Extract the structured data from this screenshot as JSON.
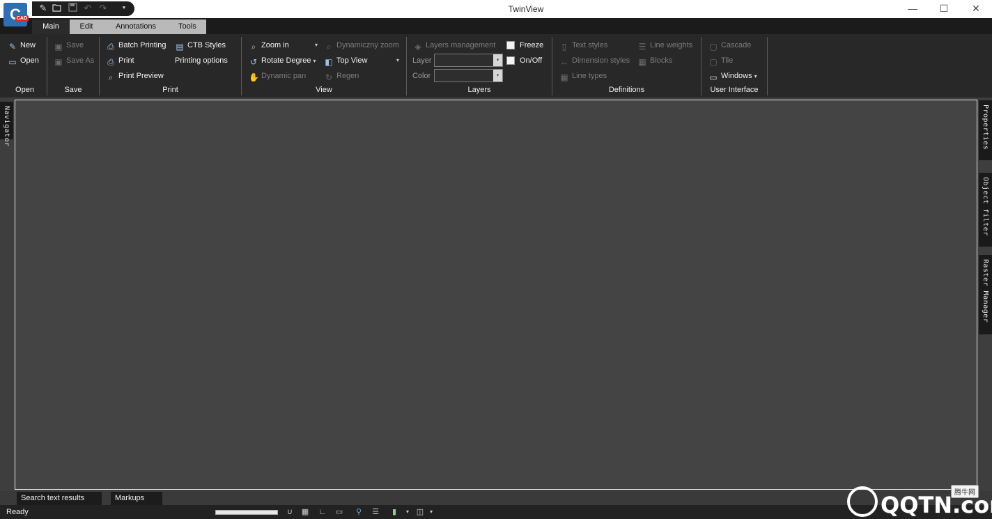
{
  "window": {
    "title": "TwinView",
    "logo_text": "C",
    "logo_badge": "CAD",
    "minimize": "—",
    "maximize": "☐",
    "close": "✕"
  },
  "quick_access": {
    "new_icon": "✎",
    "open_icon": "📂",
    "save_icon": "💾",
    "undo_icon": "↶",
    "redo_icon": "↷",
    "customize_icon": "⯆"
  },
  "tabs": [
    {
      "label": "Main"
    },
    {
      "label": "Edit"
    },
    {
      "label": "Annotations"
    },
    {
      "label": "Tools"
    }
  ],
  "ribbon": {
    "open": {
      "label": "Open",
      "new": "New",
      "open": "Open"
    },
    "save": {
      "label": "Save",
      "save": "Save",
      "save_as": "Save As"
    },
    "print": {
      "label": "Print",
      "batch_printing": "Batch Printing",
      "ctb_styles": "CTB Styles",
      "print": "Print",
      "printing_options": "Printing options",
      "print_preview": "Print Preview"
    },
    "view": {
      "label": "View",
      "zoom_in": "Zoom in",
      "dynamic_zoom": "Dynamiczny zoom",
      "rotate_degree": "Rotate Degree",
      "top_view": "Top View",
      "dynamic_pan": "Dynamic pan",
      "regen": "Regen"
    },
    "layers": {
      "label": "Layers",
      "layers_management": "Layers management",
      "freeze": "Freeze",
      "layer": "Layer",
      "on_off": "On/Off",
      "color": "Color",
      "layer_value": "",
      "color_value": ""
    },
    "definitions": {
      "label": "Definitions",
      "text_styles": "Text styles",
      "line_weights": "Line weights",
      "dimension_styles": "Dimension styles",
      "blocks": "Blocks",
      "line_types": "Line types"
    },
    "user_interface": {
      "label": "User Interface",
      "cascade": "Cascade",
      "tile": "Tile",
      "windows": "Windows"
    }
  },
  "side_panels": {
    "left": "Navigator",
    "right": [
      "Properties",
      "Object filter",
      "Raster Manager"
    ]
  },
  "bottom_tabs": [
    "Search text results",
    "Markups"
  ],
  "status": {
    "text": "Ready"
  },
  "watermark": {
    "text": "QQTN.com",
    "badge": "腾牛网"
  }
}
